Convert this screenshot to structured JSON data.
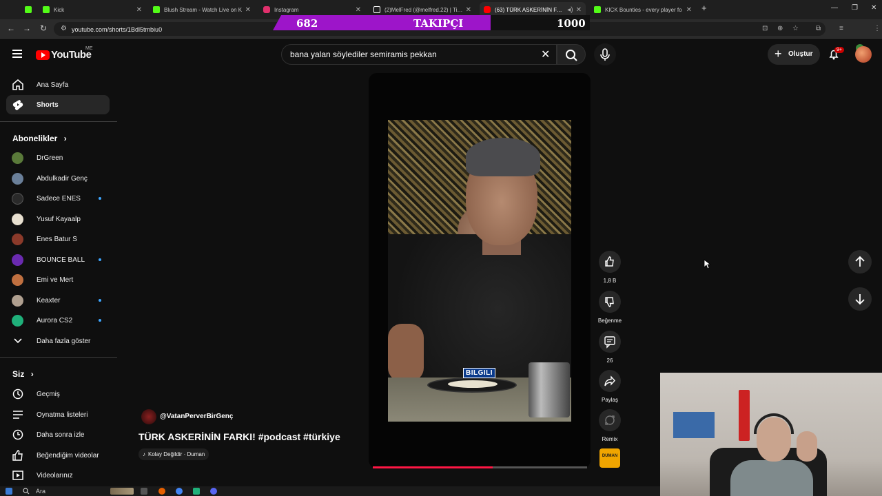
{
  "browser": {
    "tabs": [
      {
        "title": "",
        "favicon": "kick-icon",
        "color": "#53fc18"
      },
      {
        "title": "Kick",
        "favicon": "kick-icon",
        "color": "#53fc18"
      },
      {
        "title": "Blush Stream - Watch Live on K",
        "favicon": "kick-icon",
        "color": "#53fc18"
      },
      {
        "title": "Instagram",
        "favicon": "instagram-icon",
        "color": "#e1306c"
      },
      {
        "title": "(2)MelFred (@melfred.22) | TikT",
        "favicon": "tiktok-icon",
        "color": "#ffffff"
      },
      {
        "title": "(63) TÜRK ASKERİNİN FARK",
        "favicon": "youtube-icon",
        "color": "#ff0000"
      },
      {
        "title": "KICK Bounties - every player fo",
        "favicon": "kick-icon",
        "color": "#53fc18"
      }
    ],
    "url": "youtube.com/shorts/1Bdl5tmbiu0"
  },
  "stream_overlay": {
    "current": "682",
    "label": "TAKIPÇI",
    "goal": "1000"
  },
  "header": {
    "logo_text": "YouTube",
    "country": "ME",
    "search_query": "bana yalan söylediler semiramis pekkan",
    "create_label": "Oluştur",
    "notification_count": "9+"
  },
  "sidebar": {
    "main": [
      {
        "label": "Ana Sayfa",
        "icon": "home-icon"
      },
      {
        "label": "Shorts",
        "icon": "shorts-icon",
        "active": true
      }
    ],
    "subscriptions_heading": "Abonelikler",
    "subscriptions": [
      {
        "label": "DrGreen",
        "color": "#5a7a3a",
        "live": false
      },
      {
        "label": "Abdulkadir Genç",
        "color": "#6a7f99",
        "live": false
      },
      {
        "label": "Sadece ENES",
        "color": "#2a2a2a",
        "live": true
      },
      {
        "label": "Yusuf Kayaalp",
        "color": "#e8e0d0",
        "live": false
      },
      {
        "label": "Enes Batur S",
        "color": "#8b3a2a",
        "live": false
      },
      {
        "label": "BOUNCE BALL",
        "color": "#6a2ab0",
        "live": true
      },
      {
        "label": "Emi ve Mert",
        "color": "#c07040",
        "live": false
      },
      {
        "label": "Keaxter",
        "color": "#b0a090",
        "live": true
      },
      {
        "label": "Aurora CS2",
        "color": "#1fb07a",
        "live": true
      }
    ],
    "show_more": "Daha fazla göster",
    "you_heading": "Siz",
    "you_items": [
      {
        "label": "Geçmiş",
        "icon": "history-icon"
      },
      {
        "label": "Oynatma listeleri",
        "icon": "playlist-icon"
      },
      {
        "label": "Daha sonra izle",
        "icon": "clock-icon"
      },
      {
        "label": "Beğendiğim videolar",
        "icon": "thumbs-up-icon"
      },
      {
        "label": "Videolarınız",
        "icon": "video-icon"
      }
    ]
  },
  "short": {
    "caption": "BILGILI",
    "channel": "@VatanPerverBirGenç",
    "title": "TÜRK ASKERİNİN FARKI! #podcast #türkiye",
    "music": "Kolay Değildir · Duman",
    "progress": 0.56
  },
  "actions": {
    "like_count": "1,8 B",
    "dislike_label": "Beğenme",
    "comment_count": "26",
    "share_label": "Paylaş",
    "remix_label": "Remix",
    "music_thumb_text": "DUMAN"
  },
  "taskbar": {
    "search_placeholder": "Ara"
  }
}
